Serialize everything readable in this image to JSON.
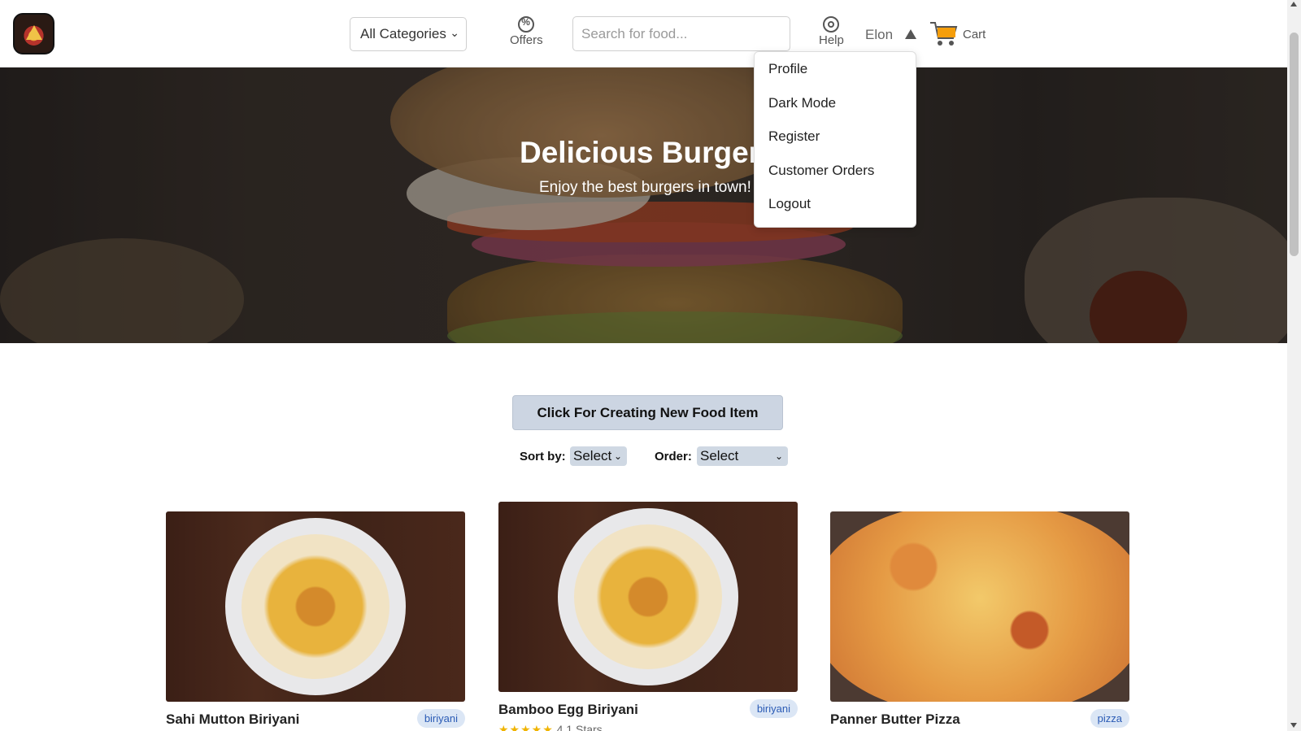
{
  "header": {
    "category_select": {
      "value": "All Categories",
      "options": [
        "All Categories"
      ]
    },
    "offers_label": "Offers",
    "search": {
      "placeholder": "Search for food...",
      "value": ""
    },
    "help_label": "Help",
    "user_name": "Elon",
    "cart_label": "Cart"
  },
  "user_menu": {
    "items": [
      {
        "label": "Profile"
      },
      {
        "label": "Dark Mode"
      },
      {
        "label": "Register"
      },
      {
        "label": "Customer Orders"
      },
      {
        "label": "Logout"
      }
    ]
  },
  "hero": {
    "title": "Delicious Burgers",
    "subtitle": "Enjoy the best burgers in town!"
  },
  "main": {
    "create_button_label": "Click For Creating New Food Item",
    "sort": {
      "label": "Sort by:",
      "value": "Select"
    },
    "order": {
      "label": "Order:",
      "value": "Select"
    }
  },
  "cards": [
    {
      "title": "Sahi Mutton Biriyani",
      "badge": "biriyani",
      "image": "biriyani-plate"
    },
    {
      "title": "Bamboo Egg Biriyani",
      "badge": "biriyani",
      "image": "biriyani-plate",
      "rating_stars": 5,
      "rating_text": "4.1 Stars"
    },
    {
      "title": "Panner Butter Pizza",
      "badge": "pizza",
      "image": "pizza"
    }
  ],
  "icons": {
    "offers": "percent-badge-icon",
    "help": "lifebuoy-icon",
    "user_caret": "caret-up-icon",
    "cart": "shopping-cart-icon"
  },
  "colors": {
    "create_button_bg": "#ccd5e2",
    "badge_bg": "#dbe6f5",
    "badge_text": "#2b5bb5",
    "cart_orange": "#f59e0b",
    "star": "#f0b400"
  }
}
